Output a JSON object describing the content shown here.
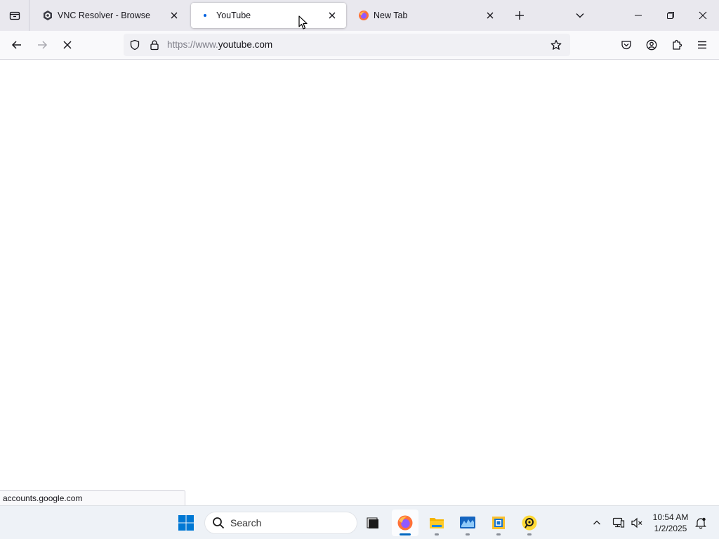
{
  "browser": {
    "tabs": [
      {
        "title": "VNC Resolver - Browse",
        "favicon": "vnc-icon",
        "selected": false
      },
      {
        "title": "YouTube",
        "favicon": "loading-dot-icon",
        "selected": true
      },
      {
        "title": "New Tab",
        "favicon": "firefox-icon",
        "selected": false
      }
    ],
    "url": {
      "prefix": "https://www.",
      "domain": "youtube.com"
    },
    "status_text": "accounts.google.com",
    "accent_color": "#0060df"
  },
  "taskbar": {
    "search_placeholder": "Search",
    "clock_time": "10:54 AM",
    "clock_date": "1/2/2025",
    "accent_color": "#0067c0"
  }
}
